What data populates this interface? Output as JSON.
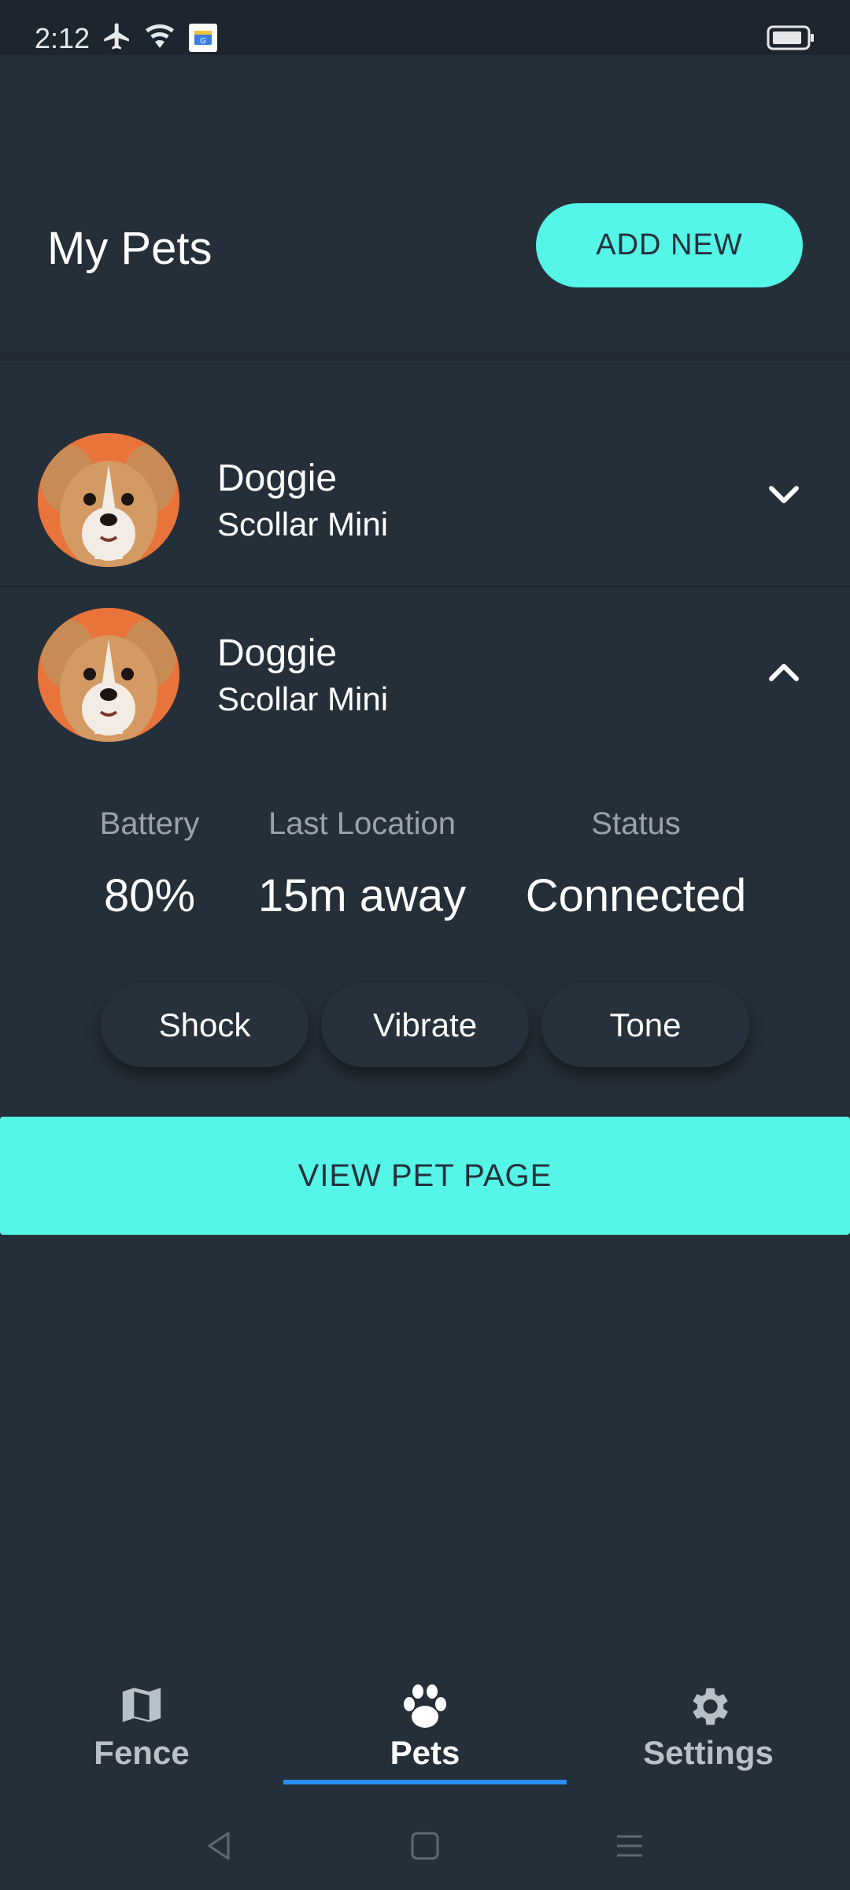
{
  "status_bar": {
    "time": "2:12"
  },
  "header": {
    "title": "My Pets",
    "add_button": "ADD NEW"
  },
  "pets": [
    {
      "name": "Doggie",
      "model": "Scollar Mini",
      "expanded": false
    },
    {
      "name": "Doggie",
      "model": "Scollar Mini",
      "expanded": true
    }
  ],
  "details": {
    "battery_label": "Battery",
    "battery_value": "80%",
    "location_label": "Last Location",
    "location_value": "15m away",
    "status_label": "Status",
    "status_value": "Connected",
    "actions": [
      "Shock",
      "Vibrate",
      "Tone"
    ],
    "view_button": "VIEW PET PAGE"
  },
  "nav": {
    "items": [
      {
        "label": "Fence",
        "icon": "map-icon",
        "active": false
      },
      {
        "label": "Pets",
        "icon": "paw-icon",
        "active": true
      },
      {
        "label": "Settings",
        "icon": "gear-icon",
        "active": false
      }
    ]
  },
  "colors": {
    "accent": "#55f5e8",
    "background": "#252f39",
    "active_underline": "#2a8ff0"
  }
}
